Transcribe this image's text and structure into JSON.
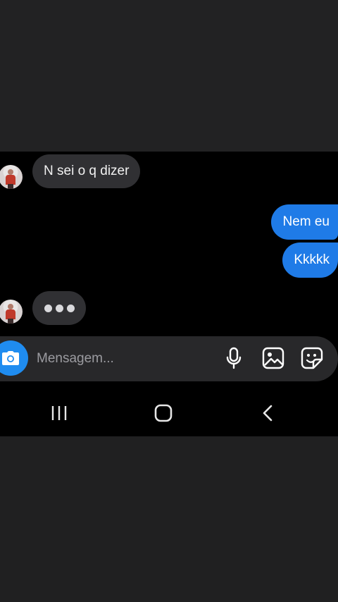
{
  "conversation": {
    "messages": [
      {
        "direction": "incoming",
        "text": "N sei o q dizer"
      },
      {
        "direction": "outgoing",
        "text": "Nem eu"
      },
      {
        "direction": "outgoing",
        "text": "Kkkkk"
      }
    ],
    "typing_indicator": true
  },
  "composer": {
    "placeholder": "Mensagem...",
    "icons": [
      "camera-icon",
      "microphone-icon",
      "gallery-icon",
      "sticker-icon"
    ]
  },
  "system_nav": {
    "icons": [
      "recent-apps-icon",
      "home-icon",
      "back-icon"
    ]
  },
  "colors": {
    "outgoing_bubble": "#1f7be7",
    "incoming_bubble": "#303033",
    "camera_button": "#1f8cf0",
    "background": "#000000"
  }
}
